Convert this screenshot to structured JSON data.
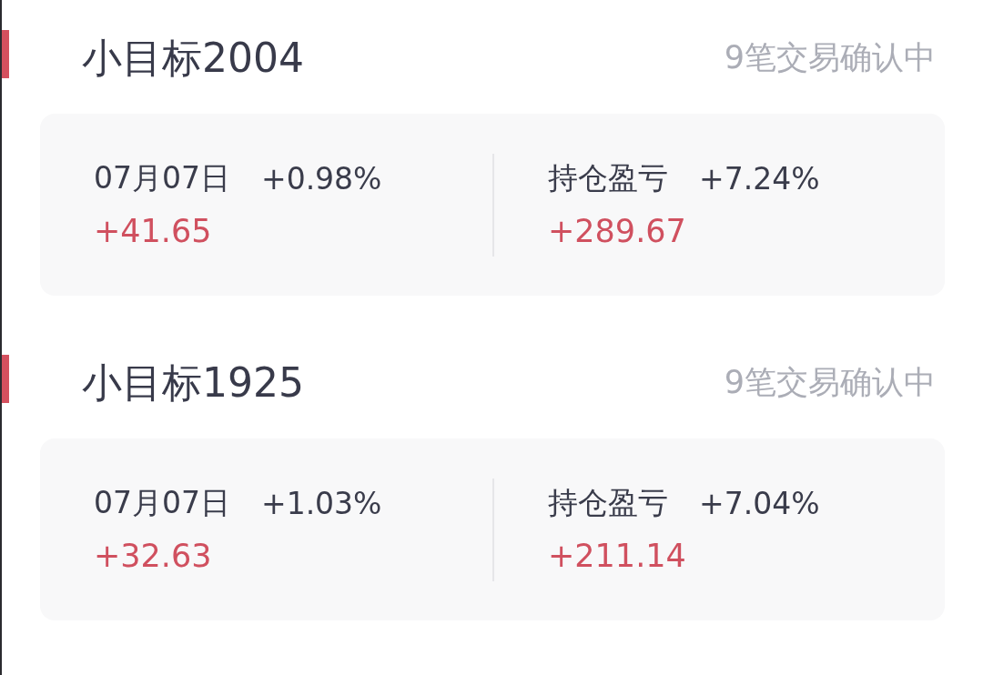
{
  "goals": [
    {
      "title": "小目标2004",
      "status": "9笔交易确认中",
      "daily": {
        "date": "07月07日",
        "change": "+0.98%",
        "amount": "+41.65"
      },
      "holding": {
        "label": "持仓盈亏",
        "change": "+7.24%",
        "amount": "+289.67"
      }
    },
    {
      "title": "小目标1925",
      "status": "9笔交易确认中",
      "daily": {
        "date": "07月07日",
        "change": "+1.03%",
        "amount": "+32.63"
      },
      "holding": {
        "label": "持仓盈亏",
        "change": "+7.04%",
        "amount": "+211.14"
      }
    }
  ]
}
